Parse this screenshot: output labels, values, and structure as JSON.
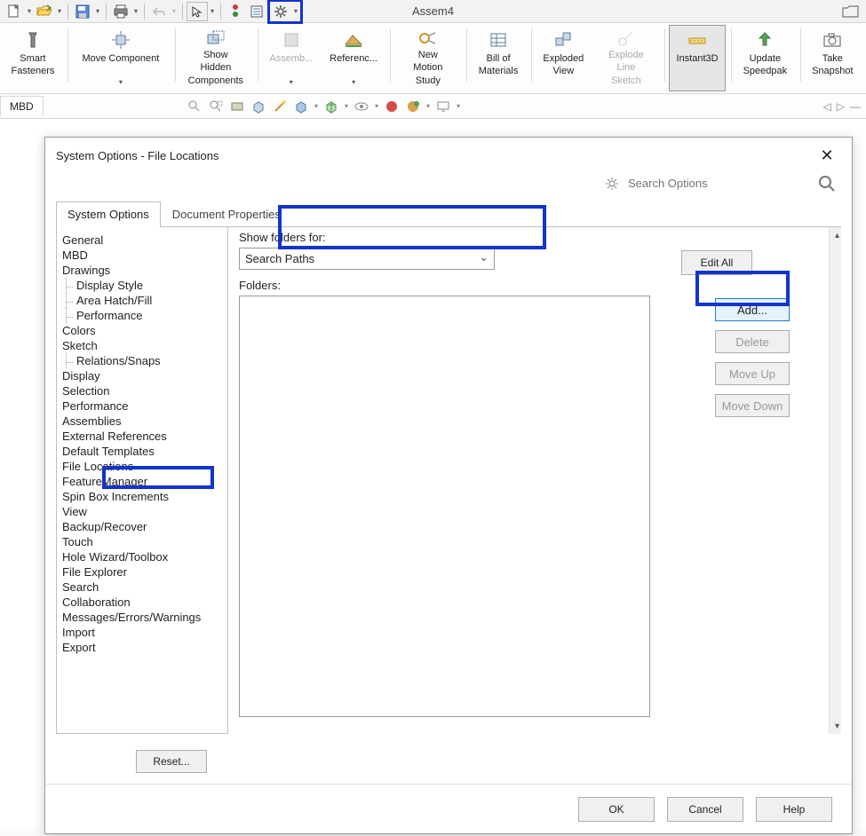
{
  "window": {
    "title": "Assem4"
  },
  "dialog": {
    "title": "System Options - File Locations",
    "search_placeholder": "Search Options",
    "tabs": {
      "system_options": "System Options",
      "document_properties": "Document Properties"
    },
    "tree": [
      "General",
      "MBD",
      "Drawings",
      "Display Style",
      "Area Hatch/Fill",
      "Performance",
      "Colors",
      "Sketch",
      "Relations/Snaps",
      "Display",
      "Selection",
      "Performance",
      "Assemblies",
      "External References",
      "Default Templates",
      "File Locations",
      "FeatureManager",
      "Spin Box Increments",
      "View",
      "Backup/Recover",
      "Touch",
      "Hole Wizard/Toolbox",
      "File Explorer",
      "Search",
      "Collaboration",
      "Messages/Errors/Warnings",
      "Import",
      "Export"
    ],
    "show_folders_label": "Show folders for:",
    "show_folders_value": "Search Paths",
    "folders_label": "Folders:",
    "edit_all": "Edit All",
    "add": "Add...",
    "delete": "Delete",
    "move_up": "Move Up",
    "move_down": "Move Down",
    "reset": "Reset...",
    "ok": "OK",
    "cancel": "Cancel",
    "help": "Help"
  },
  "subtab": {
    "mbd": "MBD"
  },
  "ribbon": {
    "smart_fasteners": "Smart\nFasteners",
    "move_component": "Move Component",
    "show_hidden": "Show Hidden\nComponents",
    "assemb": "Assemb...",
    "referenc": "Referenc...",
    "new_motion": "New Motion\nStudy",
    "bom": "Bill of\nMaterials",
    "exploded": "Exploded\nView",
    "explode_line": "Explode\nLine Sketch",
    "instant3d": "Instant3D",
    "update_speedpak": "Update\nSpeedpak",
    "take_snapshot": "Take\nSnapshot"
  }
}
